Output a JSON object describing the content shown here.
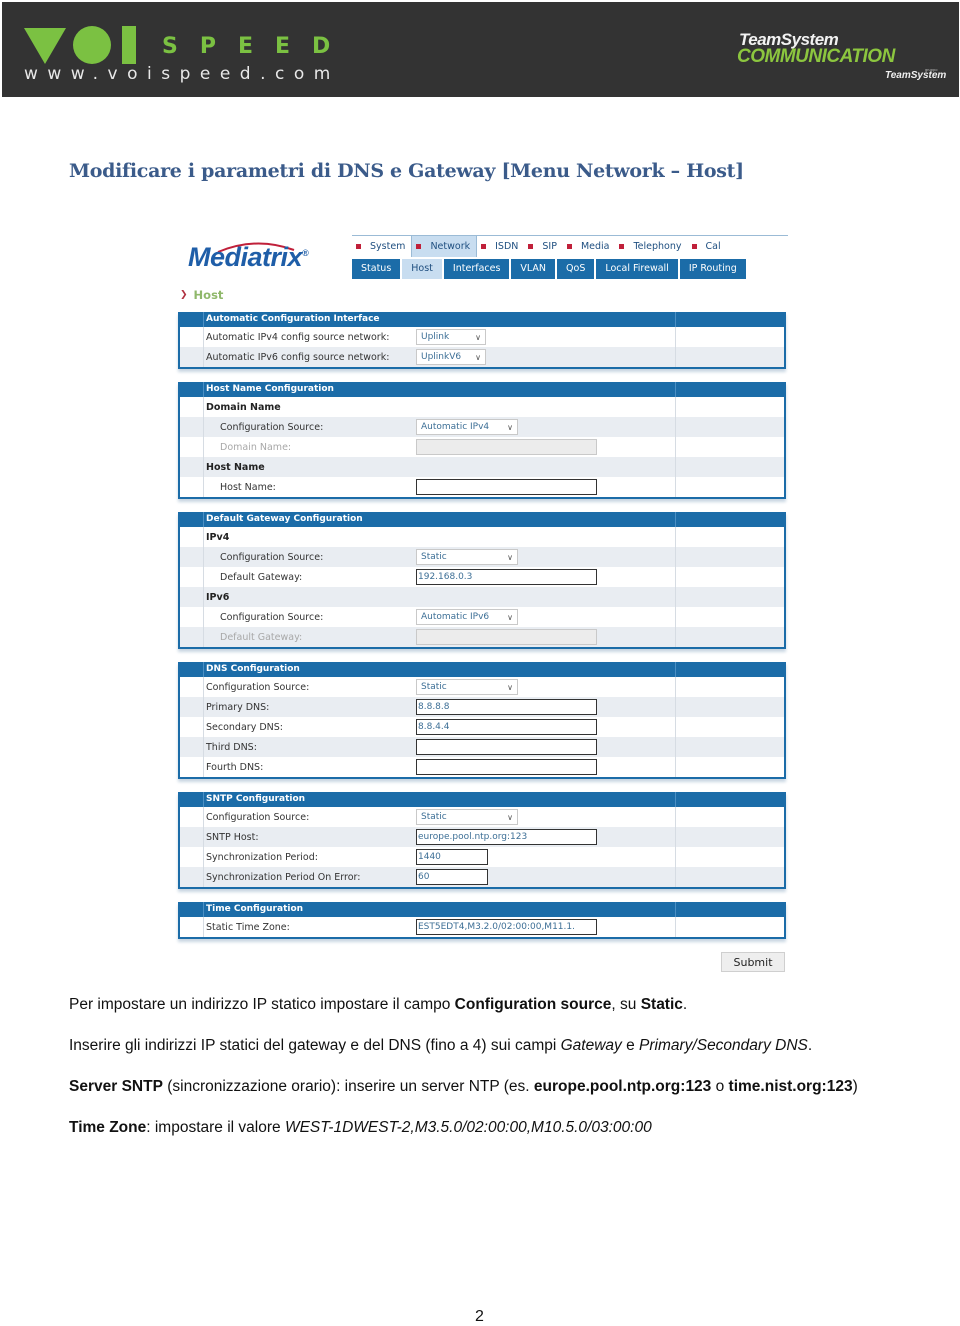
{
  "header": {
    "left_logo": {
      "brand": "VOI SPEED",
      "wordmark": "SPEED",
      "url": "www.voispeed.com",
      "accent_color": "#7bc142"
    },
    "right_logo": {
      "line1": "TeamSystem",
      "line2": "COMMUNICATION",
      "gruppo": "gruppo",
      "line3": "TeamSystem",
      "accent_color": "#8cc63f"
    }
  },
  "document": {
    "title": "Modificare i parametri di DNS e Gateway [Menu Network – Host]",
    "paragraphs": [
      {
        "parts": [
          {
            "t": "Per impostare un indirizzo IP statico impostare il campo ",
            "s": "n"
          },
          {
            "t": "Configuration source",
            "s": "b"
          },
          {
            "t": ", su ",
            "s": "n"
          },
          {
            "t": "Static",
            "s": "b"
          },
          {
            "t": ".",
            "s": "n"
          }
        ]
      },
      {
        "parts": [
          {
            "t": "Inserire gli indirizzi IP statici del gateway e del DNS (fino a 4) sui campi ",
            "s": "n"
          },
          {
            "t": "Gateway",
            "s": "i"
          },
          {
            "t": " e ",
            "s": "n"
          },
          {
            "t": "Primary/Secondary DNS",
            "s": "i"
          },
          {
            "t": ".",
            "s": "n"
          }
        ]
      },
      {
        "parts": [
          {
            "t": "Server SNTP",
            "s": "b"
          },
          {
            "t": " (sincronizzazione orario): inserire un server NTP (es. ",
            "s": "n"
          },
          {
            "t": "europe.pool.ntp.org:123",
            "s": "b"
          },
          {
            "t": " o ",
            "s": "n"
          },
          {
            "t": "time.nist.org:123",
            "s": "b"
          },
          {
            "t": ")",
            "s": "n"
          }
        ]
      },
      {
        "parts": [
          {
            "t": "Time Zone",
            "s": "b"
          },
          {
            "t": ": impostare il valore ",
            "s": "n"
          },
          {
            "t": "WEST-1DWEST-2,M3.5.0/02:00:00,M10.5.0/03:00:00",
            "s": "i"
          }
        ]
      }
    ],
    "page_number": "2"
  },
  "screenshot": {
    "logo": "Mediatrix",
    "logo_mark": "®",
    "nav_top": [
      {
        "label": "System",
        "active": false
      },
      {
        "label": "Network",
        "active": true
      },
      {
        "label": "ISDN",
        "active": false
      },
      {
        "label": "SIP",
        "active": false
      },
      {
        "label": "Media",
        "active": false
      },
      {
        "label": "Telephony",
        "active": false
      },
      {
        "label": "Cal",
        "active": false
      }
    ],
    "nav_sub": [
      {
        "label": "Status",
        "active": false
      },
      {
        "label": "Host",
        "active": true
      },
      {
        "label": "Interfaces",
        "active": false
      },
      {
        "label": "VLAN",
        "active": false
      },
      {
        "label": "QoS",
        "active": false
      },
      {
        "label": "Local Firewall",
        "active": false
      },
      {
        "label": "IP Routing",
        "active": false
      }
    ],
    "page_heading": "Host",
    "panels": {
      "auto_config": {
        "title": "Automatic Configuration Interface",
        "ipv4_label": "Automatic IPv4 config source network:",
        "ipv4_value": "Uplink",
        "ipv6_label": "Automatic IPv6 config source network:",
        "ipv6_value": "UplinkV6"
      },
      "host_name": {
        "title": "Host Name Configuration",
        "domain_section": "Domain Name",
        "config_source_label": "Configuration Source:",
        "config_source_value": "Automatic IPv4",
        "domain_name_label": "Domain Name:",
        "domain_name_value": "",
        "host_section": "Host Name",
        "host_name_label": "Host Name:",
        "host_name_value": ""
      },
      "gateway": {
        "title": "Default Gateway Configuration",
        "ipv4_section": "IPv4",
        "ipv4_source_label": "Configuration Source:",
        "ipv4_source_value": "Static",
        "ipv4_gateway_label": "Default Gateway:",
        "ipv4_gateway_value": "192.168.0.3",
        "ipv6_section": "IPv6",
        "ipv6_source_label": "Configuration Source:",
        "ipv6_source_value": "Automatic IPv6",
        "ipv6_gateway_label": "Default Gateway:",
        "ipv6_gateway_value": ""
      },
      "dns": {
        "title": "DNS Configuration",
        "source_label": "Configuration Source:",
        "source_value": "Static",
        "primary_label": "Primary DNS:",
        "primary_value": "8.8.8.8",
        "secondary_label": "Secondary DNS:",
        "secondary_value": "8.8.4.4",
        "third_label": "Third DNS:",
        "third_value": "",
        "fourth_label": "Fourth DNS:",
        "fourth_value": ""
      },
      "sntp": {
        "title": "SNTP Configuration",
        "source_label": "Configuration Source:",
        "source_value": "Static",
        "host_label": "SNTP Host:",
        "host_value": "europe.pool.ntp.org:123",
        "period_label": "Synchronization Period:",
        "period_value": "1440",
        "period_error_label": "Synchronization Period On Error:",
        "period_error_value": "60"
      },
      "time": {
        "title": "Time Configuration",
        "tz_label": "Static Time Zone:",
        "tz_value": "EST5EDT4,M3.2.0/02:00:00,M11.1."
      }
    },
    "submit_label": "Submit"
  }
}
